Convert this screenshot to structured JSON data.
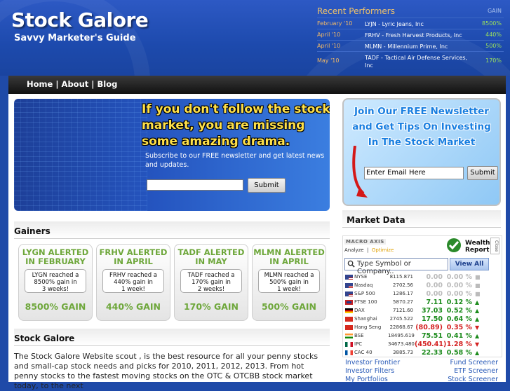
{
  "header": {
    "logo": "Stock Galore",
    "tagline": "Savvy Marketer's Guide"
  },
  "recent_performers": {
    "title": "Recent Performers",
    "gain_label": "GAIN",
    "rows": [
      {
        "month": "February '10",
        "desc": "LYJN - Lyric Jeans, Inc",
        "gain": "8500%"
      },
      {
        "month": "April '10",
        "desc": "FRHV - Fresh Harvest Products, Inc",
        "gain": "440%"
      },
      {
        "month": "April '10",
        "desc": "MLMN - Millennium Prime, Inc",
        "gain": "500%"
      },
      {
        "month": "May '10",
        "desc": "TADF - Tactical Air Defense Services, Inc",
        "gain": "170%"
      }
    ]
  },
  "nav": {
    "home": "Home",
    "about": "About",
    "blog": "Blog",
    "sep": "|"
  },
  "banner": {
    "headline": "If you don't follow the stock market, you are missing some amazing drama.",
    "subtext": "Subscribe to our FREE newsletter and get latest news and updates.",
    "input_value": "",
    "submit": "Submit"
  },
  "gainers": {
    "title": "Gainers",
    "cards": [
      {
        "title1": "LYGN ALERTED",
        "title2": "IN FEBRUARY",
        "line1": "LYGN reached a",
        "line2": "8500% gain in",
        "line3": "3 weeks!",
        "gain": "8500% GAIN"
      },
      {
        "title1": "FRHV ALERTED",
        "title2": "IN APRIL",
        "line1": "FRHV reached a",
        "line2": "440% gain in",
        "line3": "1 week!",
        "gain": "440% GAIN"
      },
      {
        "title1": "TADF ALERTED",
        "title2": "IN MAY",
        "line1": "TADF reached a",
        "line2": "170% gain in",
        "line3": "2 weeks!",
        "gain": "170% GAIN"
      },
      {
        "title1": "MLMN ALERTED",
        "title2": "IN APRIL",
        "line1": "MLMN reached a",
        "line2": "500% gain in",
        "line3": "1 week!",
        "gain": "500% GAIN"
      }
    ]
  },
  "stock_galore": {
    "title": "Stock Galore",
    "body": "The Stock Galore Website scout , is the best resource for all your penny stocks and small-cap stock needs and picks for 2010, 2011, 2012, 2013. From hot penny stocks to the fastest moving stocks on the OTC & OTCBB stock market today, to the next"
  },
  "newsletter": {
    "line1": "Join Our FREE Newsletter",
    "line2": "and Get Tips On Investing",
    "line3": "In The Stock Market",
    "email_placeholder": "Enter Email Here",
    "submit": "Submit"
  },
  "market_data": {
    "title": "Market Data",
    "brand": "MACRO AXIS",
    "tab_analyze": "Analyze",
    "tab_optimize": "Optimize",
    "wealth_line1": "Wealth",
    "wealth_line2": "Report",
    "close": "Close",
    "search_placeholder": "Type Symbol or Company..",
    "view_all": "View All",
    "rows": [
      {
        "name": "NYSE",
        "price": "8115.871",
        "change": "0.00",
        "pct": "0.00 %",
        "dir": "nc",
        "flag": "us"
      },
      {
        "name": "Nasdaq",
        "price": "2702.56",
        "change": "0.00",
        "pct": "0.00 %",
        "dir": "nc",
        "flag": "us"
      },
      {
        "name": "S&P 500",
        "price": "1286.17",
        "change": "0.00",
        "pct": "0.00 %",
        "dir": "nc",
        "flag": "us"
      },
      {
        "name": "FTSE 100",
        "price": "5870.27",
        "change": "7.11",
        "pct": "0.12 %",
        "dir": "up",
        "flag": "uk"
      },
      {
        "name": "DAX",
        "price": "7121.60",
        "change": "37.03",
        "pct": "0.52 %",
        "dir": "up",
        "flag": "de"
      },
      {
        "name": "Shanghai",
        "price": "2745.522",
        "change": "17.50",
        "pct": "0.64 %",
        "dir": "up",
        "flag": "cn"
      },
      {
        "name": "Hang Seng",
        "price": "22868.67",
        "change": "(80.89)",
        "pct": "0.35 %",
        "dir": "dn",
        "flag": "hk"
      },
      {
        "name": "BSE",
        "price": "18495.619",
        "change": "75.51",
        "pct": "0.41 %",
        "dir": "up",
        "flag": "in"
      },
      {
        "name": "IPC",
        "price": "34673.480",
        "change": "(450.41)",
        "pct": "1.28 %",
        "dir": "dn",
        "flag": "mx"
      },
      {
        "name": "CAC 40",
        "price": "3885.73",
        "change": "22.33",
        "pct": "0.58 %",
        "dir": "up",
        "flag": "fr"
      }
    ],
    "links": {
      "investor_frontier": "Investor Frontier",
      "investor_filters": "Investor Filters",
      "my_portfolios": "My Portfolios",
      "fund_screener": "Fund Screener",
      "etf_screener": "ETF Screener",
      "stock_screener": "Stock Screener"
    }
  },
  "colors": {
    "header_bg": "#1f4aa8",
    "gain_green": "#6ea73b",
    "recent_title": "#f0c36a",
    "banner_yellow": "#ffe14a",
    "link_blue": "#2a5bb8"
  }
}
